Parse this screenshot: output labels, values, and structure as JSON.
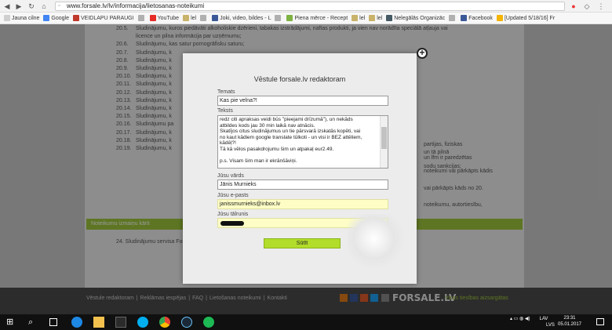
{
  "browser": {
    "url": "www.forsale.lv/lv/informacija/lietosanas-noteikumi",
    "bookmarks": [
      {
        "label": "Jauna cilne",
        "color": "#cfcfcf"
      },
      {
        "label": "Google",
        "color": "#4285f4"
      },
      {
        "label": "VEIDLAPU PARAUGI",
        "color": "#c0392b"
      },
      {
        "label": "",
        "color": "#b0b0b0"
      },
      {
        "label": "YouTube",
        "color": "#e52d27"
      },
      {
        "label": "lel",
        "color": "#c9b36a"
      },
      {
        "label": "",
        "color": "#b0b0b0"
      },
      {
        "label": "Joki, video, bildes - L",
        "color": "#3b5998"
      },
      {
        "label": "",
        "color": "#b0b0b0"
      },
      {
        "label": "Piena mērce - Recept",
        "color": "#7cb342"
      },
      {
        "label": "lel",
        "color": "#c9b36a"
      },
      {
        "label": "lel",
        "color": "#c9b36a"
      },
      {
        "label": "Nelegālās Organizāc",
        "color": "#455a64"
      },
      {
        "label": "",
        "color": "#b0b0b0"
      },
      {
        "label": "Facebook",
        "color": "#3b5998"
      },
      {
        "label": "[Updated 5/18/16] Fr",
        "color": "#f4b400"
      }
    ]
  },
  "page_bg": {
    "lines": [
      {
        "n": "20.5.",
        "t": "Sludinājumu, kuros piedāvāti alkoholiskie dzērieni, tabakas izstrādājumi, naftas produkti, ja vien nav norādīta speciālā atļauja vai"
      },
      {
        "n": "",
        "t": "licence un pilna informācija par uzņēmumu;"
      },
      {
        "n": "20.6.",
        "t": "Sludinājumu, kas satur pornogrāfisku saturu;"
      },
      {
        "n": "20.7.",
        "t": "Sludinājumu, k"
      },
      {
        "n": "20.8.",
        "t": "Sludinājumu, k"
      },
      {
        "n": "20.9.",
        "t": "Sludinājumu, k"
      },
      {
        "n": "20.10.",
        "t": "Sludinājumu, k"
      },
      {
        "n": "20.11.",
        "t": "Sludinājumu, k"
      },
      {
        "n": "20.12.",
        "t": "Sludinājumu, k"
      },
      {
        "n": "20.13.",
        "t": "Sludinājumu, k"
      },
      {
        "n": "20.14.",
        "t": "Sludinājumu, k"
      },
      {
        "n": "20.15.",
        "t": "Sludinājumu, k"
      },
      {
        "n": "20.16.",
        "t": "Sludinājumu pa"
      },
      {
        "n": "20.17.",
        "t": "Sludinājumu, k"
      },
      {
        "n": "20.18.",
        "t": "Sludinājumu, k"
      },
      {
        "n": "20.19.",
        "t": "Sludinājumu, k"
      }
    ],
    "right_text": [
      "partijas, fiziskas",
      "un tā pilnā",
      "un lfm ir paredzētas",
      "sodu sankcijas;",
      "noteikumi vai pārkāpts kādis",
      "vai pārkāpts kāds no 20.",
      "noteikumu, autortiesību,"
    ],
    "green_bar": "Noteikumu izmaiņu kārti",
    "item24": "24. Sludinājumu servisa Forsale lietotāji pieņem šo pielietojumus lietošanas noteikumus, kas ir spēkā šā lietot forsale.lv",
    "footer_links": [
      "Vēstule redaktoram",
      "Reklāmas iespējas",
      "FAQ",
      "Lietošanas noteikumi",
      "Kontakti"
    ],
    "logo": "FORSALE.LV",
    "footer_tagline": "Visas tiesības aizsargātas"
  },
  "modal": {
    "title": "Vēstule forsale.lv redaktoram",
    "subject_label": "Temats",
    "subject_value": "Kas pie velna?!",
    "text_label": "Teksts",
    "text_lines": [
      "redz citi apraksas veidi būs \"pieejami drīzumā\"), un nekāds",
      "atbildes kods jau 30 min laikā nav atnācis.",
      "Skatījos citus sludinājumus un tie pārsvarā izskatās kopēti, vai",
      "no kaut kādiem google translate tūlkoti - un visi ir BEZ attēliem,",
      "kādēļ?!",
      "Tā kā vēlos pasakdrojumu šim un atpakaļ eur2.49.",
      "",
      "p.s. Visam šim man ir ekrānšāviņi."
    ],
    "name_label": "Jūsu vārds",
    "name_value": "Jānis Murnieks",
    "email_label": "Jūsu e-pasts",
    "email_value": "janissmurnieks@inbox.lv",
    "phone_label": "Jūsu tālrunis",
    "send_label": "Sūtīt"
  },
  "taskbar": {
    "lang": "LAV",
    "layout": "LVS",
    "time": "23:31",
    "date": "05.01.2017"
  }
}
